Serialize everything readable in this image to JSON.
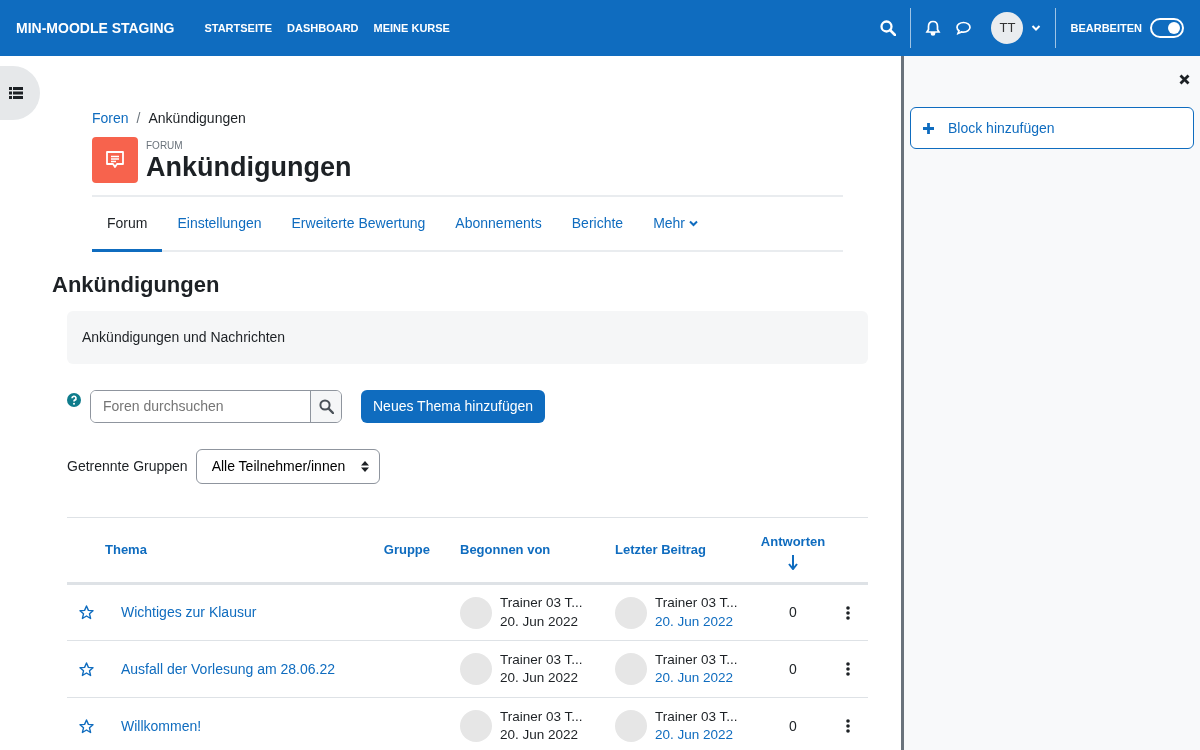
{
  "navbar": {
    "brand": "MIN-MOODLE STAGING",
    "links": [
      "STARTSEITE",
      "DASHBOARD",
      "MEINE KURSE"
    ],
    "avatar": "TT",
    "edit_label": "BEARBEITEN",
    "edit_on": true
  },
  "breadcrumb": {
    "separator": "/",
    "items": [
      {
        "label": "Foren",
        "link": true
      },
      {
        "label": "Ankündigungen",
        "link": false
      }
    ]
  },
  "header": {
    "module": "FORUM",
    "title": "Ankündigungen"
  },
  "tabs": [
    {
      "label": "Forum",
      "selected": true,
      "has_menu": false
    },
    {
      "label": "Einstellungen",
      "selected": false,
      "has_menu": false
    },
    {
      "label": "Erweiterte Bewertung",
      "selected": false,
      "has_menu": false
    },
    {
      "label": "Abonnements",
      "selected": false,
      "has_menu": false
    },
    {
      "label": "Berichte",
      "selected": false,
      "has_menu": false
    },
    {
      "label": "Mehr",
      "selected": false,
      "has_menu": true
    }
  ],
  "heading": "Ankündigungen",
  "intro": "Ankündigungen und Nachrichten",
  "search": {
    "placeholder": "Foren durchsuchen"
  },
  "add_button": "Neues Thema hinzufügen",
  "group_filter": {
    "label": "Getrennte Gruppen",
    "value": "Alle Teilnehmer/innen"
  },
  "table": {
    "columns": [
      {
        "label": "Thema",
        "sorted": false
      },
      {
        "label": "Gruppe",
        "sorted": false
      },
      {
        "label": "Begonnen von",
        "sorted": false
      },
      {
        "label": "Letzter Beitrag",
        "sorted": false
      },
      {
        "label": "Antworten",
        "sorted": true
      }
    ],
    "rows": [
      {
        "topic": "Wichtiges zur Klausur",
        "starred": false,
        "started_by": {
          "name": "Trainer 03 T...",
          "date": "20. Jun 2022"
        },
        "last_post": {
          "name": "Trainer 03 T...",
          "date": "20. Jun 2022"
        },
        "replies": "0"
      },
      {
        "topic": "Ausfall der Vorlesung am 28.06.22",
        "starred": false,
        "started_by": {
          "name": "Trainer 03 T...",
          "date": "20. Jun 2022"
        },
        "last_post": {
          "name": "Trainer 03 T...",
          "date": "20. Jun 2022"
        },
        "replies": "0"
      },
      {
        "topic": "Willkommen!",
        "starred": false,
        "started_by": {
          "name": "Trainer 03 T...",
          "date": "20. Jun 2022"
        },
        "last_post": {
          "name": "Trainer 03 T...",
          "date": "20. Jun 2022"
        },
        "replies": "0"
      }
    ]
  },
  "drawer": {
    "add_block": "Block hinzufügen"
  }
}
